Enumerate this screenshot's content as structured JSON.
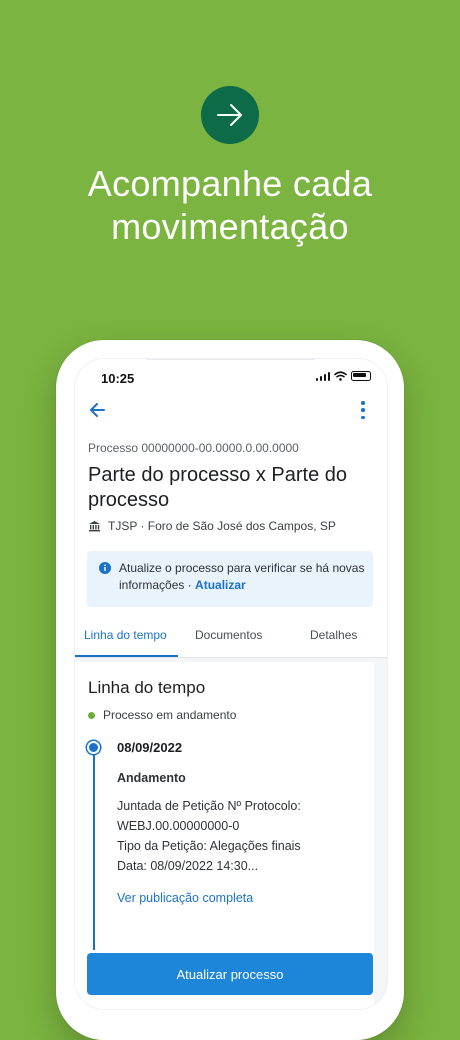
{
  "promo": {
    "icon": "arrow-right-icon",
    "headline_line1": "Acompanhe cada",
    "headline_line2": "movimentação"
  },
  "status_bar": {
    "time": "10:25",
    "icons": [
      "signal-icon",
      "wifi-icon",
      "battery-icon"
    ]
  },
  "header": {
    "back_icon": "arrow-left-icon",
    "menu_icon": "more-vertical-icon",
    "process_number": "Processo 00000000-00.0000.0.00.0000",
    "title": "Parte do processo x Parte do processo",
    "court_icon": "courthouse-icon",
    "court": "TJSP · Foro de São José dos Campos, SP"
  },
  "info_banner": {
    "icon": "info-icon",
    "text": "Atualize o processo para verificar se há novas informações · ",
    "link": "Atualizar"
  },
  "tabs": [
    {
      "label": "Linha do tempo",
      "active": true
    },
    {
      "label": "Documentos",
      "active": false
    },
    {
      "label": "Detalhes",
      "active": false
    }
  ],
  "timeline": {
    "title": "Linha do tempo",
    "status": "Processo em andamento",
    "entries": [
      {
        "date": "08/09/2022",
        "type": "Andamento",
        "description_lines": [
          "Juntada de Petição Nº Protocolo:",
          "WEBJ.00.00000000-0",
          "Tipo da Petição: Alegações finais",
          "Data: 08/09/2022 14:30..."
        ],
        "link": "Ver publicação completa"
      }
    ]
  },
  "footer": {
    "update_button": "Atualizar processo"
  },
  "colors": {
    "background": "#7bb440",
    "promo_icon": "#0d6b47",
    "accent": "#1a73c9",
    "button": "#1e86d9",
    "status_dot": "#6fae3d",
    "info_bg": "#e8f3fb"
  }
}
